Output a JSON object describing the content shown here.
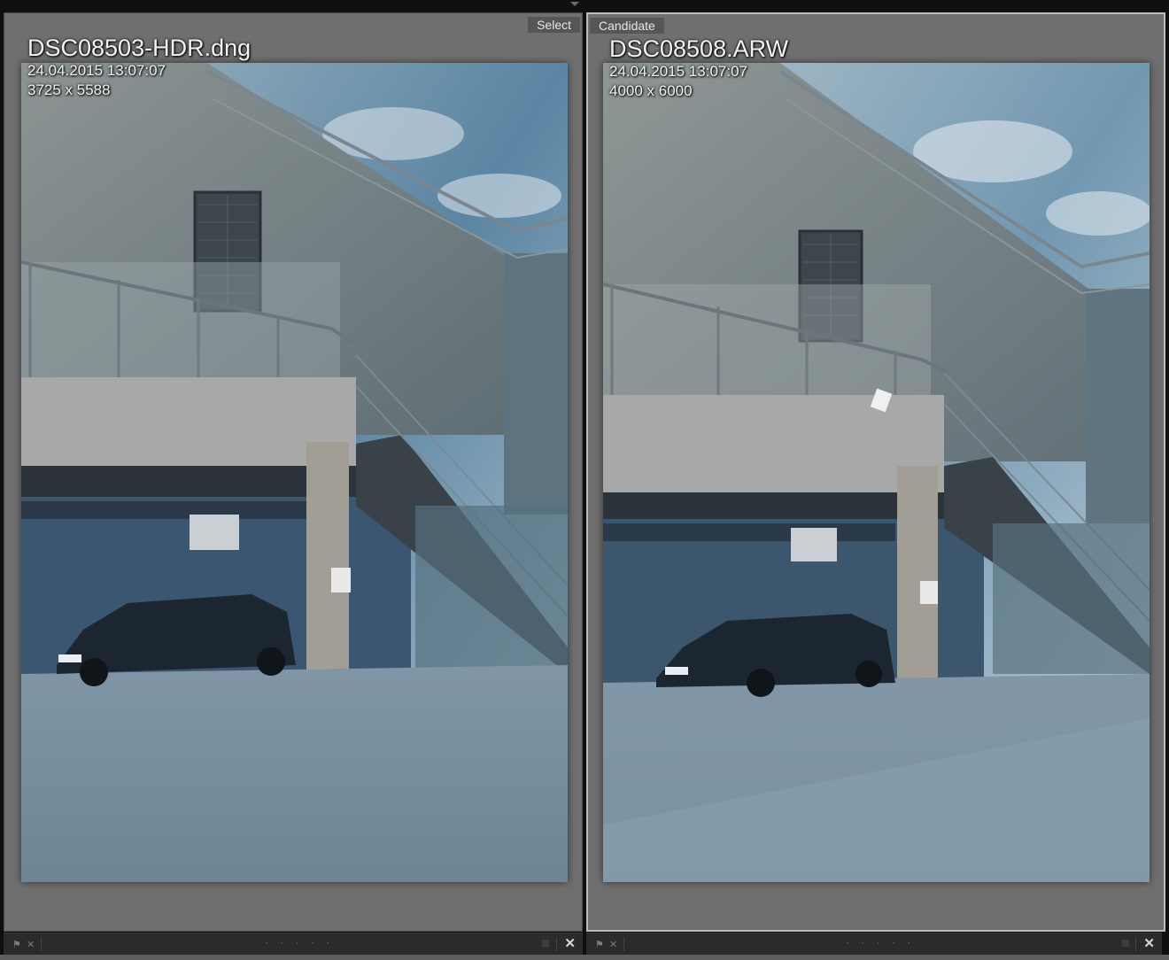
{
  "left_pane": {
    "label": "Select",
    "filename": "DSC08503-HDR.dng",
    "datetime": "24.04.2015 13:07:07",
    "dimensions": "3725 x 5588"
  },
  "right_pane": {
    "label": "Candidate",
    "filename": "DSC08508.ARW",
    "datetime": "24.04.2015 13:07:07",
    "dimensions": "4000 x 6000"
  },
  "toolbar": {
    "rating_dots": "· · · · ·",
    "close_glyph": "✕",
    "flag_glyph": "⚑"
  },
  "icons": {
    "flag": "flag-icon",
    "reject": "reject-flag-icon",
    "close": "close-icon",
    "collapse": "chevron-down-icon"
  },
  "colors": {
    "pane_bg": "#6f6f6f",
    "active_border": "#bdbdbd",
    "toolbar_bg": "#2b2b2b"
  }
}
